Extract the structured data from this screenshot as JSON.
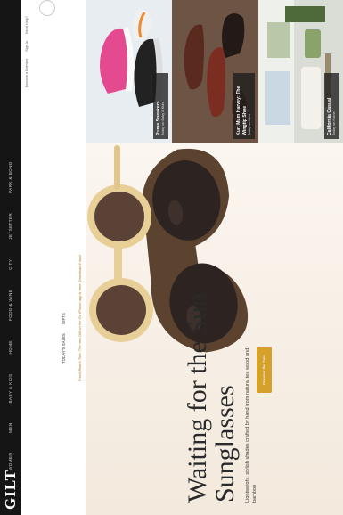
{
  "brand": {
    "logo": "GILT"
  },
  "nav": {
    "items": [
      "WOMEN",
      "MEN",
      "BABY & KIDS",
      "HOME",
      "FOOD & WINE",
      "CITY",
      "JETSETTER",
      "PARK & BOND"
    ]
  },
  "account": {
    "become_member": "Become a Member",
    "sign_in": "Sign In",
    "need_help": "Need Help?"
  },
  "tabs": [
    "TODAY'S SALES",
    "GIFTS"
  ],
  "promo": "Fresh Beach Tote: The new Gift on the Go iPhone app is here. Download it now!",
  "hero": {
    "headline": "Waiting for the Sun Sunglasses",
    "subhead": "Lightweight, stylish shades crafted by hand from natural tea wood and bamboo",
    "cta": "Preview the Sale"
  },
  "tiles": [
    {
      "title": "Puma Sneakers",
      "sub": "Today on Baby & Kids"
    },
    {
      "title": "Kurt Mum Harvey: The Wingtip Shoe",
      "sub": "Today on Men"
    },
    {
      "title": "California Casual",
      "sub": "Today on Home"
    }
  ],
  "colors": {
    "nav_bg": "#151515",
    "accent": "#d6a12a",
    "promo": "#b77b18"
  }
}
